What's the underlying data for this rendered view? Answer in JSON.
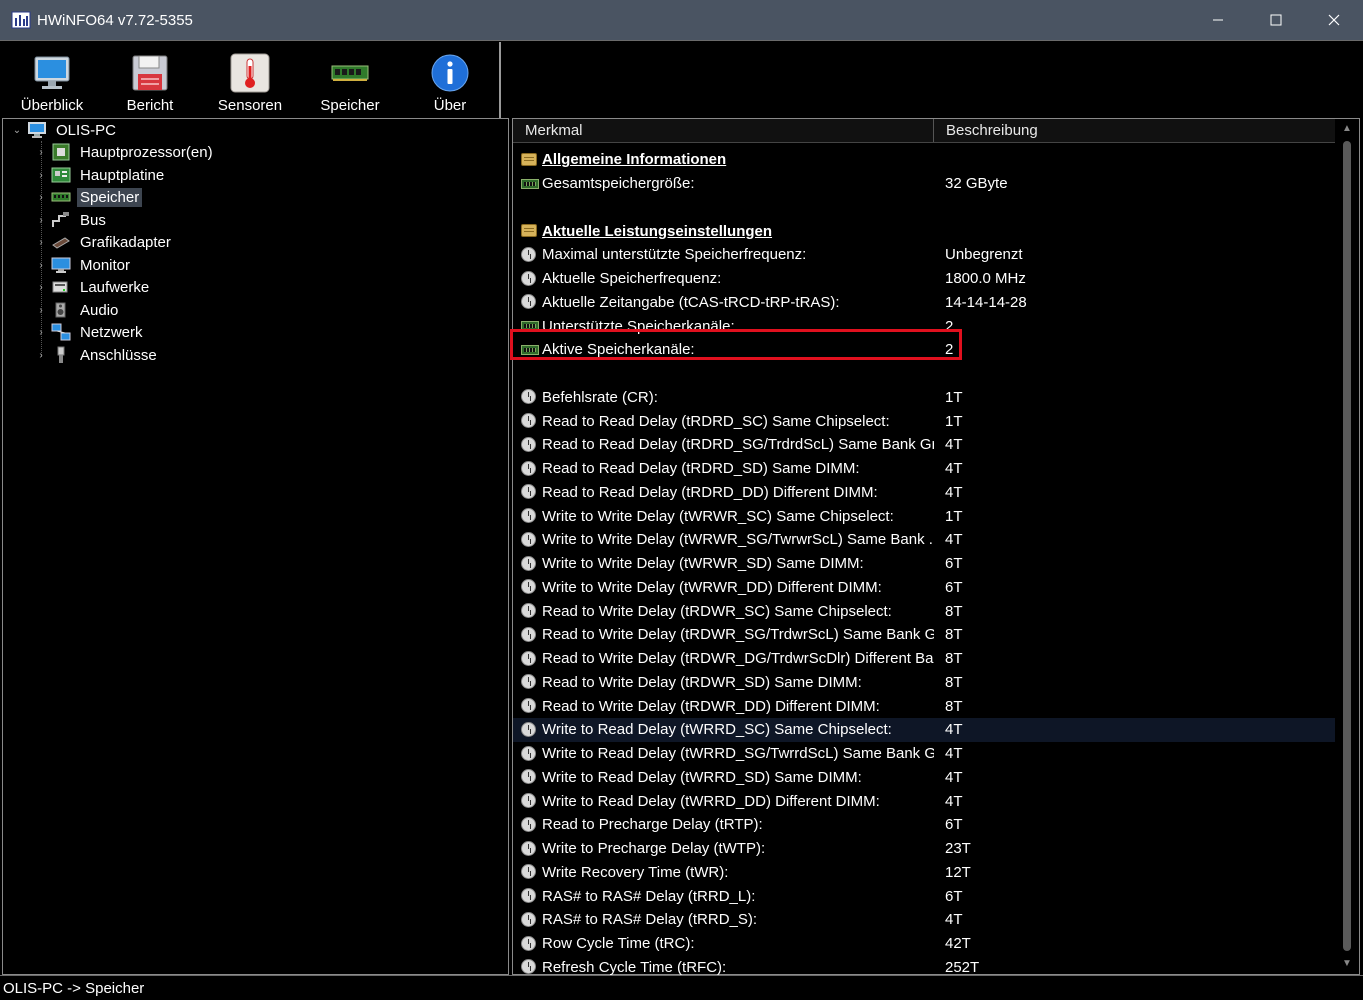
{
  "window": {
    "title": "HWiNFO64 v7.72-5355",
    "minimize_icon": "minimize-icon",
    "maximize_icon": "maximize-icon",
    "close_icon": "close-icon"
  },
  "toolbar": {
    "buttons": [
      {
        "label": "Überblick",
        "icon": "monitor-icon"
      },
      {
        "label": "Bericht",
        "icon": "floppy-disk-icon"
      },
      {
        "label": "Sensoren",
        "icon": "thermometer-icon"
      },
      {
        "label": "Speicher",
        "icon": "ram-module-icon"
      },
      {
        "label": "Über",
        "icon": "info-icon"
      }
    ]
  },
  "tree": {
    "root": {
      "label": "OLIS-PC",
      "icon": "computer-icon"
    },
    "items": [
      {
        "label": "Hauptprozessor(en)",
        "icon": "cpu-icon"
      },
      {
        "label": "Hauptplatine",
        "icon": "motherboard-icon"
      },
      {
        "label": "Speicher",
        "icon": "ram-icon",
        "selected": true
      },
      {
        "label": "Bus",
        "icon": "bus-icon"
      },
      {
        "label": "Grafikadapter",
        "icon": "gpu-icon"
      },
      {
        "label": "Monitor",
        "icon": "monitor-icon"
      },
      {
        "label": "Laufwerke",
        "icon": "drive-icon"
      },
      {
        "label": "Audio",
        "icon": "speaker-icon"
      },
      {
        "label": "Netzwerk",
        "icon": "network-icon"
      },
      {
        "label": "Anschlüsse",
        "icon": "port-icon"
      }
    ]
  },
  "list": {
    "columns": [
      "Merkmal",
      "Beschreibung"
    ],
    "rows": [
      {
        "type": "section",
        "icon": "book-icon",
        "name": "Allgemeine Informationen",
        "value": ""
      },
      {
        "type": "item",
        "icon": "ram-icon",
        "name": "Gesamtspeichergröße:",
        "value": "32 GByte"
      },
      {
        "type": "blank",
        "name": "",
        "value": ""
      },
      {
        "type": "section",
        "icon": "book-icon",
        "name": "Aktuelle Leistungseinstellungen",
        "value": ""
      },
      {
        "type": "item",
        "icon": "clock-icon",
        "name": "Maximal unterstützte Speicherfrequenz:",
        "value": "Unbegrenzt"
      },
      {
        "type": "item",
        "icon": "clock-icon",
        "name": "Aktuelle Speicherfrequenz:",
        "value": "1800.0 MHz"
      },
      {
        "type": "item",
        "icon": "clock-icon",
        "name": "Aktuelle Zeitangabe (tCAS-tRCD-tRP-tRAS):",
        "value": "14-14-14-28"
      },
      {
        "type": "item",
        "icon": "ram-icon",
        "name": "Unterstützte Speicherkanäle:",
        "value": "2"
      },
      {
        "type": "item",
        "icon": "ram-icon",
        "name": "Aktive Speicherkanäle:",
        "value": "2"
      },
      {
        "type": "blank",
        "name": "",
        "value": ""
      },
      {
        "type": "item",
        "icon": "clock-icon",
        "name": "Befehlsrate (CR):",
        "value": "1T"
      },
      {
        "type": "item",
        "icon": "clock-icon",
        "name": "Read to Read Delay (tRDRD_SC) Same Chipselect:",
        "value": "1T"
      },
      {
        "type": "item",
        "icon": "clock-icon",
        "name": "Read to Read Delay (tRDRD_SG/TrdrdScL) Same Bank Gro...",
        "value": "4T"
      },
      {
        "type": "item",
        "icon": "clock-icon",
        "name": "Read to Read Delay (tRDRD_SD) Same DIMM:",
        "value": "4T"
      },
      {
        "type": "item",
        "icon": "clock-icon",
        "name": "Read to Read Delay (tRDRD_DD) Different DIMM:",
        "value": "4T"
      },
      {
        "type": "item",
        "icon": "clock-icon",
        "name": "Write to Write Delay (tWRWR_SC) Same Chipselect:",
        "value": "1T"
      },
      {
        "type": "item",
        "icon": "clock-icon",
        "name": "Write to Write Delay (tWRWR_SG/TwrwrScL) Same Bank ...",
        "value": "4T"
      },
      {
        "type": "item",
        "icon": "clock-icon",
        "name": "Write to Write Delay (tWRWR_SD) Same DIMM:",
        "value": "6T"
      },
      {
        "type": "item",
        "icon": "clock-icon",
        "name": "Write to Write Delay (tWRWR_DD) Different DIMM:",
        "value": "6T"
      },
      {
        "type": "item",
        "icon": "clock-icon",
        "name": "Read to Write Delay (tRDWR_SC) Same Chipselect:",
        "value": "8T"
      },
      {
        "type": "item",
        "icon": "clock-icon",
        "name": "Read to Write Delay (tRDWR_SG/TrdwrScL) Same Bank Gr...",
        "value": "8T"
      },
      {
        "type": "item",
        "icon": "clock-icon",
        "name": "Read to Write Delay (tRDWR_DG/TrdwrScDlr) Different Ba...",
        "value": "8T"
      },
      {
        "type": "item",
        "icon": "clock-icon",
        "name": "Read to Write Delay (tRDWR_SD) Same DIMM:",
        "value": "8T"
      },
      {
        "type": "item",
        "icon": "clock-icon",
        "name": "Read to Write Delay (tRDWR_DD) Different DIMM:",
        "value": "8T"
      },
      {
        "type": "item",
        "icon": "clock-icon",
        "name": "Write to Read Delay (tWRRD_SC) Same Chipselect:",
        "value": "4T",
        "highlight": true
      },
      {
        "type": "item",
        "icon": "clock-icon",
        "name": "Write to Read Delay (tWRRD_SG/TwrrdScL) Same Bank Gr...",
        "value": "4T"
      },
      {
        "type": "item",
        "icon": "clock-icon",
        "name": "Write to Read Delay (tWRRD_SD) Same DIMM:",
        "value": "4T"
      },
      {
        "type": "item",
        "icon": "clock-icon",
        "name": "Write to Read Delay (tWRRD_DD) Different DIMM:",
        "value": "4T"
      },
      {
        "type": "item",
        "icon": "clock-icon",
        "name": "Read to Precharge Delay (tRTP):",
        "value": "6T"
      },
      {
        "type": "item",
        "icon": "clock-icon",
        "name": "Write to Precharge Delay (tWTP):",
        "value": "23T"
      },
      {
        "type": "item",
        "icon": "clock-icon",
        "name": "Write Recovery Time (tWR):",
        "value": "12T"
      },
      {
        "type": "item",
        "icon": "clock-icon",
        "name": "RAS# to RAS# Delay (tRRD_L):",
        "value": "6T"
      },
      {
        "type": "item",
        "icon": "clock-icon",
        "name": "RAS# to RAS# Delay (tRRD_S):",
        "value": "4T"
      },
      {
        "type": "item",
        "icon": "clock-icon",
        "name": "Row Cycle Time (tRC):",
        "value": "42T"
      },
      {
        "type": "item",
        "icon": "clock-icon",
        "name": "Refresh Cycle Time (tRFC):",
        "value": "252T"
      }
    ]
  },
  "statusbar": {
    "text": "OLIS-PC -> Speicher"
  },
  "colors": {
    "titlebar": "#4a5462",
    "selection": "#3d4550",
    "row_highlight": "#0e1626",
    "annotation_box": "#e0101e"
  }
}
